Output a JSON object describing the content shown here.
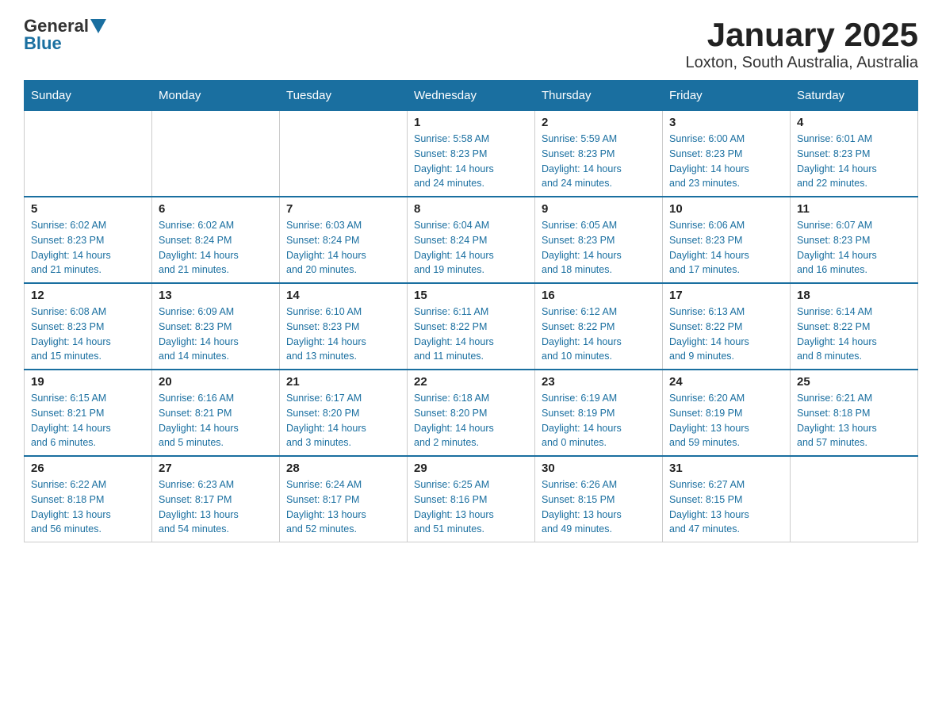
{
  "header": {
    "logo_general": "General",
    "logo_blue": "Blue",
    "title": "January 2025",
    "subtitle": "Loxton, South Australia, Australia"
  },
  "days_of_week": [
    "Sunday",
    "Monday",
    "Tuesday",
    "Wednesday",
    "Thursday",
    "Friday",
    "Saturday"
  ],
  "weeks": [
    [
      {
        "day": "",
        "info": ""
      },
      {
        "day": "",
        "info": ""
      },
      {
        "day": "",
        "info": ""
      },
      {
        "day": "1",
        "info": "Sunrise: 5:58 AM\nSunset: 8:23 PM\nDaylight: 14 hours\nand 24 minutes."
      },
      {
        "day": "2",
        "info": "Sunrise: 5:59 AM\nSunset: 8:23 PM\nDaylight: 14 hours\nand 24 minutes."
      },
      {
        "day": "3",
        "info": "Sunrise: 6:00 AM\nSunset: 8:23 PM\nDaylight: 14 hours\nand 23 minutes."
      },
      {
        "day": "4",
        "info": "Sunrise: 6:01 AM\nSunset: 8:23 PM\nDaylight: 14 hours\nand 22 minutes."
      }
    ],
    [
      {
        "day": "5",
        "info": "Sunrise: 6:02 AM\nSunset: 8:23 PM\nDaylight: 14 hours\nand 21 minutes."
      },
      {
        "day": "6",
        "info": "Sunrise: 6:02 AM\nSunset: 8:24 PM\nDaylight: 14 hours\nand 21 minutes."
      },
      {
        "day": "7",
        "info": "Sunrise: 6:03 AM\nSunset: 8:24 PM\nDaylight: 14 hours\nand 20 minutes."
      },
      {
        "day": "8",
        "info": "Sunrise: 6:04 AM\nSunset: 8:24 PM\nDaylight: 14 hours\nand 19 minutes."
      },
      {
        "day": "9",
        "info": "Sunrise: 6:05 AM\nSunset: 8:23 PM\nDaylight: 14 hours\nand 18 minutes."
      },
      {
        "day": "10",
        "info": "Sunrise: 6:06 AM\nSunset: 8:23 PM\nDaylight: 14 hours\nand 17 minutes."
      },
      {
        "day": "11",
        "info": "Sunrise: 6:07 AM\nSunset: 8:23 PM\nDaylight: 14 hours\nand 16 minutes."
      }
    ],
    [
      {
        "day": "12",
        "info": "Sunrise: 6:08 AM\nSunset: 8:23 PM\nDaylight: 14 hours\nand 15 minutes."
      },
      {
        "day": "13",
        "info": "Sunrise: 6:09 AM\nSunset: 8:23 PM\nDaylight: 14 hours\nand 14 minutes."
      },
      {
        "day": "14",
        "info": "Sunrise: 6:10 AM\nSunset: 8:23 PM\nDaylight: 14 hours\nand 13 minutes."
      },
      {
        "day": "15",
        "info": "Sunrise: 6:11 AM\nSunset: 8:22 PM\nDaylight: 14 hours\nand 11 minutes."
      },
      {
        "day": "16",
        "info": "Sunrise: 6:12 AM\nSunset: 8:22 PM\nDaylight: 14 hours\nand 10 minutes."
      },
      {
        "day": "17",
        "info": "Sunrise: 6:13 AM\nSunset: 8:22 PM\nDaylight: 14 hours\nand 9 minutes."
      },
      {
        "day": "18",
        "info": "Sunrise: 6:14 AM\nSunset: 8:22 PM\nDaylight: 14 hours\nand 8 minutes."
      }
    ],
    [
      {
        "day": "19",
        "info": "Sunrise: 6:15 AM\nSunset: 8:21 PM\nDaylight: 14 hours\nand 6 minutes."
      },
      {
        "day": "20",
        "info": "Sunrise: 6:16 AM\nSunset: 8:21 PM\nDaylight: 14 hours\nand 5 minutes."
      },
      {
        "day": "21",
        "info": "Sunrise: 6:17 AM\nSunset: 8:20 PM\nDaylight: 14 hours\nand 3 minutes."
      },
      {
        "day": "22",
        "info": "Sunrise: 6:18 AM\nSunset: 8:20 PM\nDaylight: 14 hours\nand 2 minutes."
      },
      {
        "day": "23",
        "info": "Sunrise: 6:19 AM\nSunset: 8:19 PM\nDaylight: 14 hours\nand 0 minutes."
      },
      {
        "day": "24",
        "info": "Sunrise: 6:20 AM\nSunset: 8:19 PM\nDaylight: 13 hours\nand 59 minutes."
      },
      {
        "day": "25",
        "info": "Sunrise: 6:21 AM\nSunset: 8:18 PM\nDaylight: 13 hours\nand 57 minutes."
      }
    ],
    [
      {
        "day": "26",
        "info": "Sunrise: 6:22 AM\nSunset: 8:18 PM\nDaylight: 13 hours\nand 56 minutes."
      },
      {
        "day": "27",
        "info": "Sunrise: 6:23 AM\nSunset: 8:17 PM\nDaylight: 13 hours\nand 54 minutes."
      },
      {
        "day": "28",
        "info": "Sunrise: 6:24 AM\nSunset: 8:17 PM\nDaylight: 13 hours\nand 52 minutes."
      },
      {
        "day": "29",
        "info": "Sunrise: 6:25 AM\nSunset: 8:16 PM\nDaylight: 13 hours\nand 51 minutes."
      },
      {
        "day": "30",
        "info": "Sunrise: 6:26 AM\nSunset: 8:15 PM\nDaylight: 13 hours\nand 49 minutes."
      },
      {
        "day": "31",
        "info": "Sunrise: 6:27 AM\nSunset: 8:15 PM\nDaylight: 13 hours\nand 47 minutes."
      },
      {
        "day": "",
        "info": ""
      }
    ]
  ]
}
